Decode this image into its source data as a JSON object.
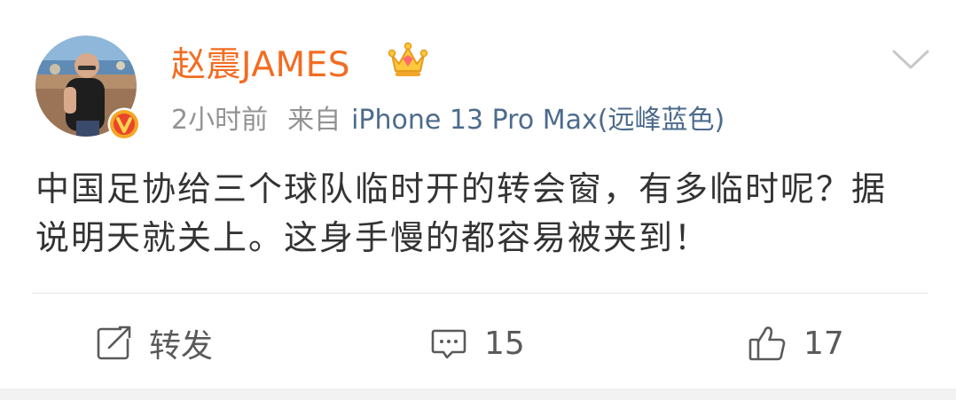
{
  "post": {
    "author": {
      "name": "赵震JAMES",
      "avatar_icon": "user-avatar-photo",
      "verified_icon": "verified-v-badge",
      "member_icon": "vip-crown-icon"
    },
    "time": "2小时前",
    "source_prefix": "来自",
    "source_device": "iPhone 13 Pro Max(远峰蓝色)",
    "text": "中国足协给三个球队临时开的转会窗，有多临时呢？据说明天就关上。这身手慢的都容易被夹到！",
    "actions": {
      "repost_label": "转发",
      "comment_count": "15",
      "like_count": "17"
    }
  },
  "colors": {
    "username": "#f36c21",
    "meta_gray": "#939393",
    "device_blue": "#4d6b8c",
    "body_text": "#333333",
    "action_text": "#5a5a5a",
    "verified_badge": "#f5a623",
    "divider": "#e8e8e8"
  }
}
